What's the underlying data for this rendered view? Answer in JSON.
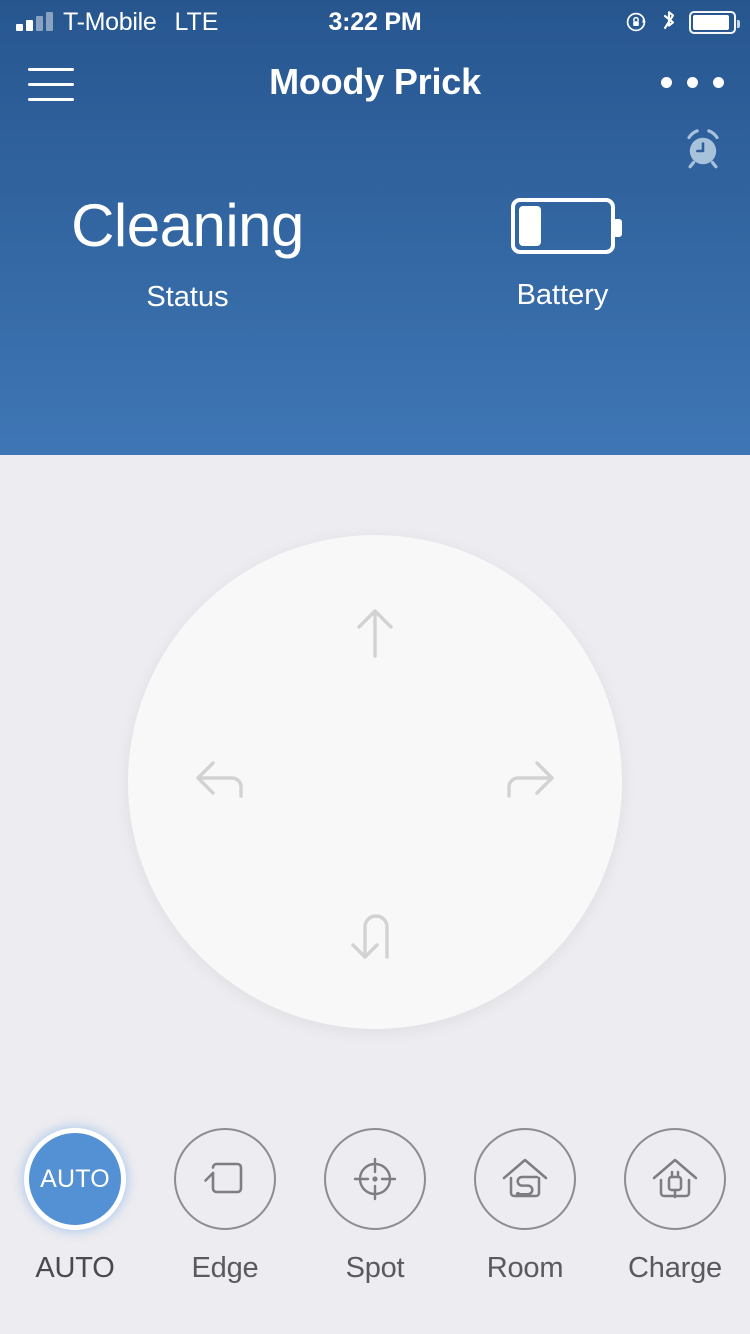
{
  "status_bar": {
    "carrier": "T-Mobile",
    "network": "LTE",
    "time": "3:22 PM",
    "signal_bars_filled": 2,
    "signal_bars_total": 4,
    "icons": [
      "rotation-lock-icon",
      "bluetooth-icon",
      "battery-icon"
    ],
    "battery_level_percent": 92
  },
  "nav": {
    "menu_icon": "hamburger-menu-icon",
    "title": "Moody Prick",
    "more_icon": "more-options-icon"
  },
  "header": {
    "alarm_icon": "alarm-clock-icon",
    "accent_color": "#356aa6",
    "background_top": "#27568f",
    "background_bottom": "#3f76b5"
  },
  "hero": {
    "status_value": "Cleaning",
    "status_label": "Status",
    "battery_label": "Battery",
    "battery_level_percent": 25,
    "battery_icon": "battery-icon"
  },
  "dpad": {
    "up": {
      "label": "Forward",
      "icon": "arrow-up-icon"
    },
    "left": {
      "label": "Turn Left",
      "icon": "turn-left-icon"
    },
    "right": {
      "label": "Turn Right",
      "icon": "turn-right-icon"
    },
    "back": {
      "label": "U-Turn",
      "icon": "u-turn-icon"
    },
    "arrow_color": "#d2d2d4",
    "surface_color": "#f8f8f9"
  },
  "modes": {
    "active_color": "#5490d4",
    "inactive_color": "#8d8d91",
    "items": [
      {
        "label": "AUTO",
        "icon": "auto-mode-icon",
        "badge_text": "AUTO",
        "active": true
      },
      {
        "label": "Edge",
        "icon": "edge-clean-icon",
        "badge_text": "",
        "active": false
      },
      {
        "label": "Spot",
        "icon": "spot-clean-icon",
        "badge_text": "",
        "active": false
      },
      {
        "label": "Room",
        "icon": "room-clean-icon",
        "badge_text": "",
        "active": false
      },
      {
        "label": "Charge",
        "icon": "charge-dock-icon",
        "badge_text": "",
        "active": false
      }
    ]
  }
}
